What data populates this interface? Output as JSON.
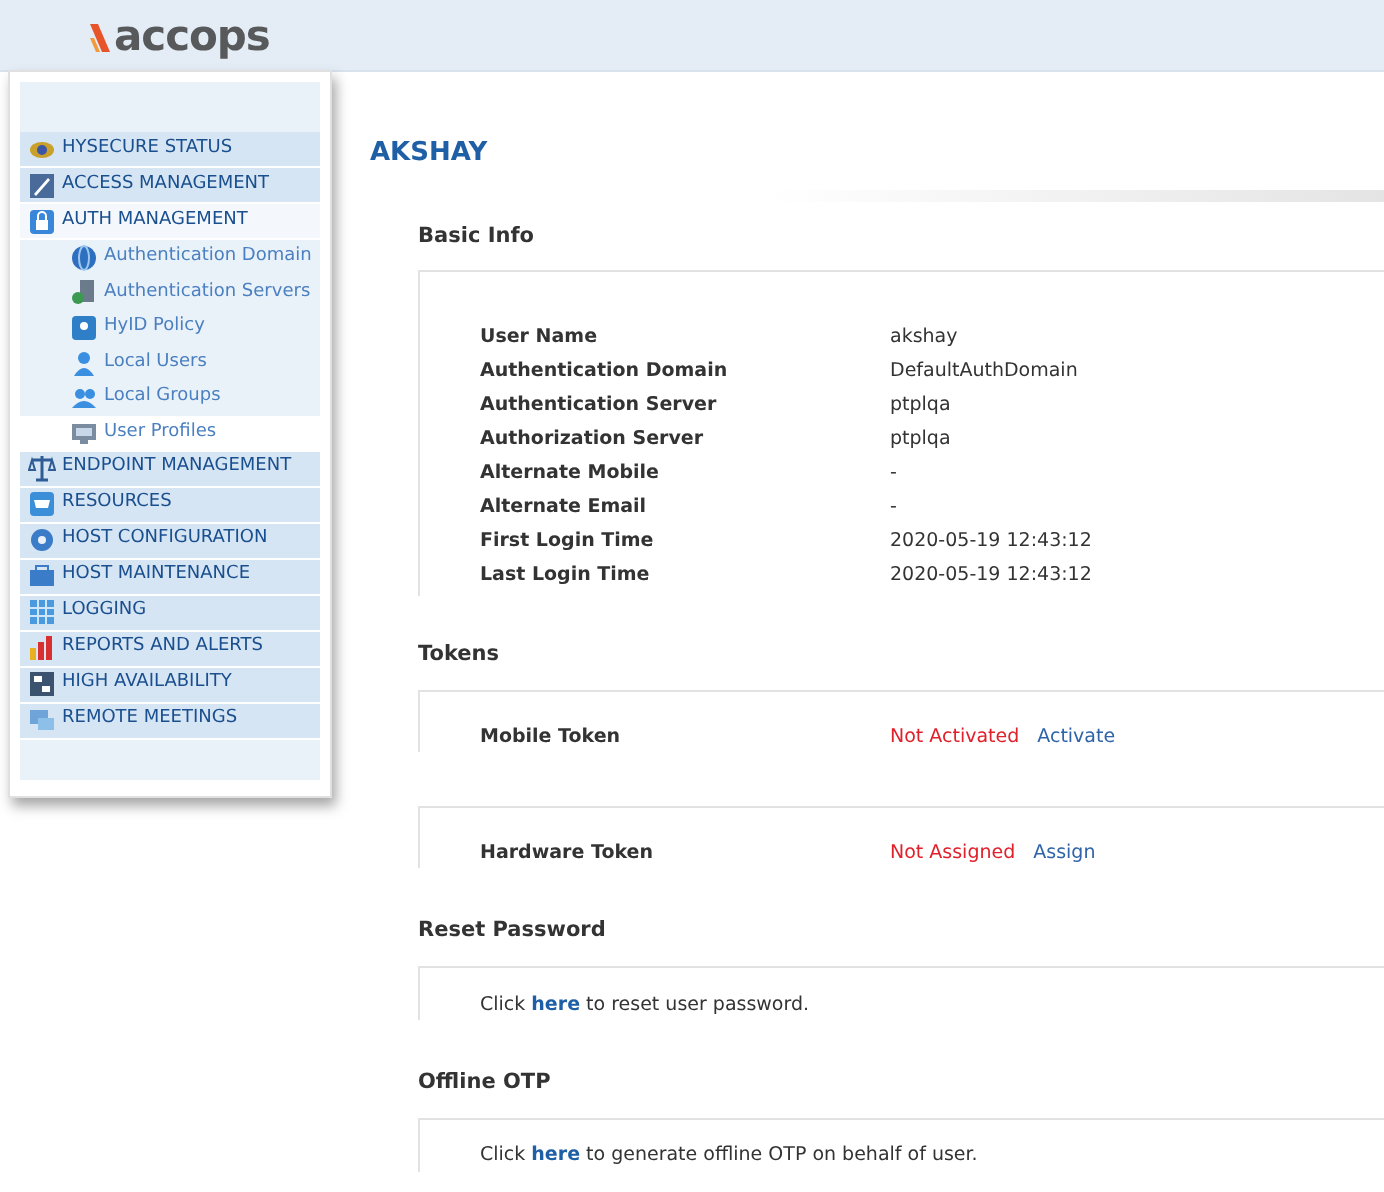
{
  "logo": {
    "text": "accops"
  },
  "menu": [
    {
      "label": "HYSECURE STATUS",
      "selected": false,
      "expanded": false
    },
    {
      "label": "ACCESS MANAGEMENT",
      "selected": false,
      "expanded": false
    },
    {
      "label": "AUTH MANAGEMENT",
      "selected": false,
      "expanded": true,
      "children": [
        {
          "label": "Authentication Domain",
          "selected": false
        },
        {
          "label": "Authentication Servers",
          "selected": false
        },
        {
          "label": "HyID Policy",
          "selected": false
        },
        {
          "label": "Local Users",
          "selected": false
        },
        {
          "label": "Local Groups",
          "selected": false
        },
        {
          "label": "User Profiles",
          "selected": true
        }
      ]
    },
    {
      "label": "ENDPOINT MANAGEMENT",
      "selected": false,
      "expanded": false
    },
    {
      "label": "RESOURCES",
      "selected": false,
      "expanded": false
    },
    {
      "label": "HOST CONFIGURATION",
      "selected": false,
      "expanded": false
    },
    {
      "label": "HOST MAINTENANCE",
      "selected": false,
      "expanded": false
    },
    {
      "label": "LOGGING",
      "selected": false,
      "expanded": false
    },
    {
      "label": "REPORTS AND ALERTS",
      "selected": false,
      "expanded": false
    },
    {
      "label": "HIGH AVAILABILITY",
      "selected": false,
      "expanded": false
    },
    {
      "label": "REMOTE MEETINGS",
      "selected": false,
      "expanded": false
    }
  ],
  "page_title": "AKSHAY",
  "basic_info": {
    "heading": "Basic Info",
    "rows": [
      {
        "label": "User Name",
        "value": "akshay"
      },
      {
        "label": "Authentication Domain",
        "value": "DefaultAuthDomain"
      },
      {
        "label": "Authentication Server",
        "value": "ptplqa"
      },
      {
        "label": "Authorization Server",
        "value": "ptplqa"
      },
      {
        "label": "Alternate Mobile",
        "value": "-"
      },
      {
        "label": "Alternate Email",
        "value": "-"
      },
      {
        "label": "First Login Time",
        "value": "2020-05-19 12:43:12"
      },
      {
        "label": "Last Login Time",
        "value": "2020-05-19 12:43:12"
      }
    ]
  },
  "tokens": {
    "heading": "Tokens",
    "items": [
      {
        "label": "Mobile Token",
        "status": "Not Activated",
        "action": "Activate"
      },
      {
        "label": "Hardware Token",
        "status": "Not Assigned",
        "action": "Assign"
      }
    ]
  },
  "actions": [
    {
      "heading": "Reset Password",
      "before": "Click",
      "link": "here",
      "after": "to reset user password."
    },
    {
      "heading": "Offline OTP",
      "before": "Click",
      "link": "here",
      "after": "to generate offline OTP on behalf of user."
    }
  ]
}
